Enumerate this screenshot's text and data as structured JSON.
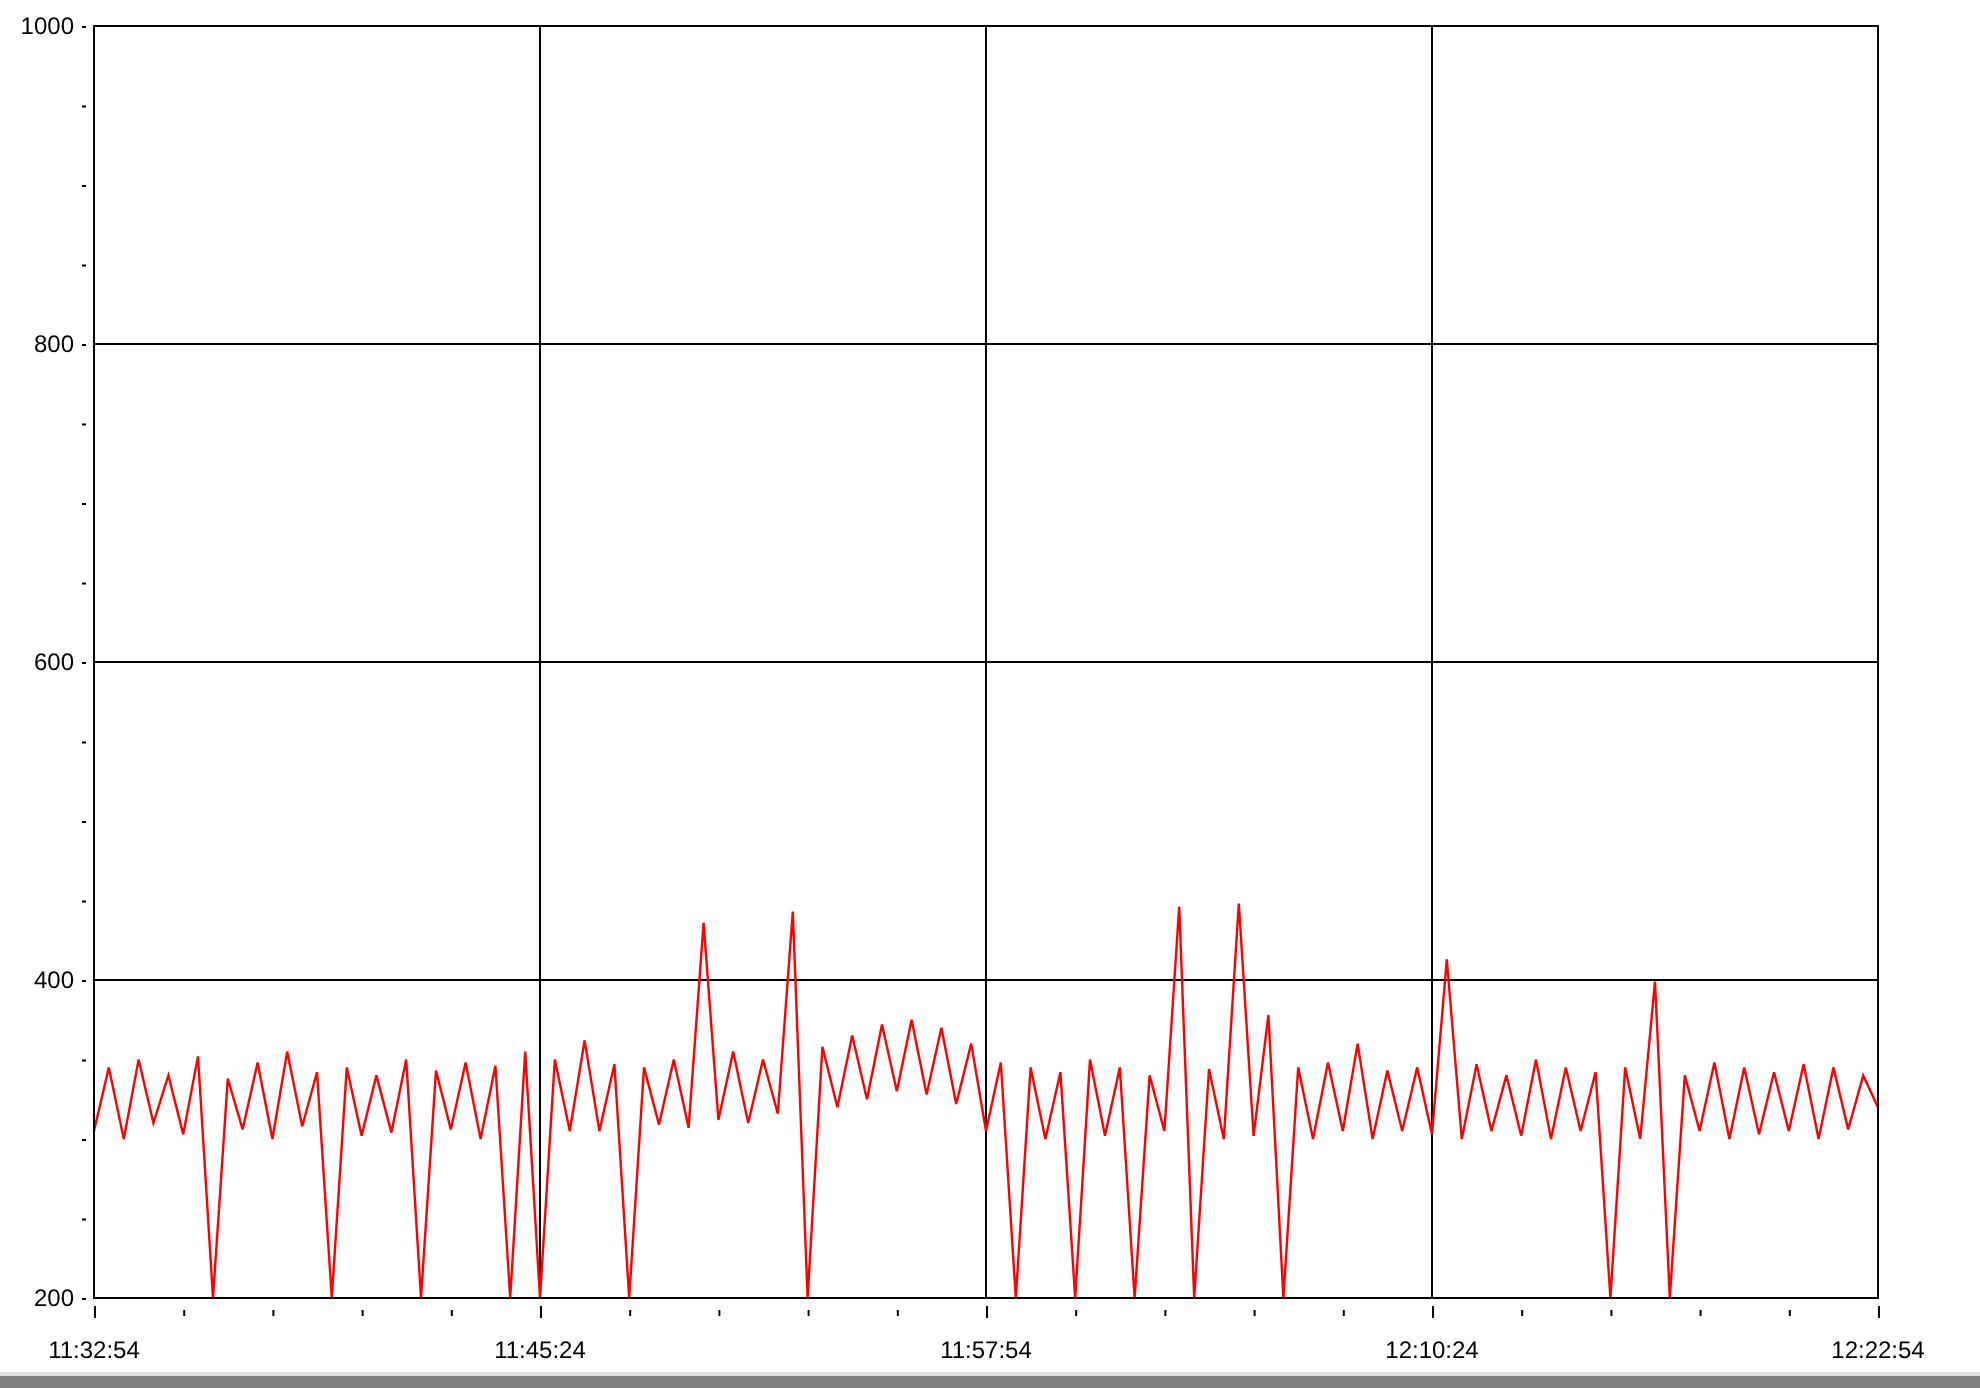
{
  "chart": {
    "chart_data": {
      "type": "line",
      "grid": true,
      "ylim": [
        200,
        1000
      ],
      "categories": [
        "11:32:54",
        null,
        null,
        null,
        null,
        null,
        null,
        null,
        null,
        null,
        null,
        null,
        null,
        null,
        null,
        null,
        null,
        null,
        null,
        null,
        null,
        null,
        null,
        null,
        null,
        null,
        null,
        null,
        null,
        null,
        "11:45:24",
        null,
        null,
        null,
        null,
        null,
        null,
        null,
        null,
        null,
        null,
        null,
        null,
        null,
        null,
        null,
        null,
        null,
        null,
        null,
        null,
        null,
        null,
        null,
        null,
        null,
        null,
        null,
        null,
        null,
        "11:57:54",
        null,
        null,
        null,
        null,
        null,
        null,
        null,
        null,
        null,
        null,
        null,
        null,
        null,
        null,
        null,
        null,
        null,
        null,
        null,
        null,
        null,
        null,
        null,
        null,
        null,
        null,
        null,
        null,
        null,
        "12:10:24",
        null,
        null,
        null,
        null,
        null,
        null,
        null,
        null,
        null,
        null,
        null,
        null,
        null,
        null,
        null,
        null,
        null,
        null,
        null,
        null,
        null,
        null,
        null,
        null,
        null,
        null,
        null,
        null,
        null,
        "12:22:54"
      ],
      "yticks": [
        200,
        400,
        600,
        800,
        1000
      ],
      "series": [
        {
          "color": "#ff0000",
          "values": [
            305,
            345,
            300,
            350,
            310,
            340,
            303,
            352,
            200,
            338,
            306,
            348,
            300,
            355,
            308,
            342,
            200,
            345,
            302,
            340,
            304,
            350,
            200,
            343,
            306,
            348,
            300,
            346,
            200,
            355,
            200,
            350,
            305,
            362,
            305,
            347,
            200,
            345,
            309,
            350,
            307,
            436,
            312,
            355,
            310,
            350,
            316,
            443,
            200,
            358,
            320,
            365,
            325,
            372,
            330,
            375,
            328,
            370,
            322,
            360,
            305,
            348,
            200,
            345,
            300,
            342,
            200,
            350,
            302,
            345,
            200,
            340,
            305,
            446,
            200,
            344,
            300,
            448,
            302,
            378,
            200,
            345,
            300,
            348,
            305,
            360,
            300,
            343,
            305,
            345,
            303,
            413,
            300,
            347,
            305,
            340,
            302,
            350,
            300,
            345,
            305,
            342,
            200,
            345,
            300,
            399,
            200,
            340,
            305,
            348,
            300,
            345,
            303,
            342,
            305,
            347,
            300,
            345,
            306,
            340,
            320
          ]
        }
      ]
    }
  }
}
